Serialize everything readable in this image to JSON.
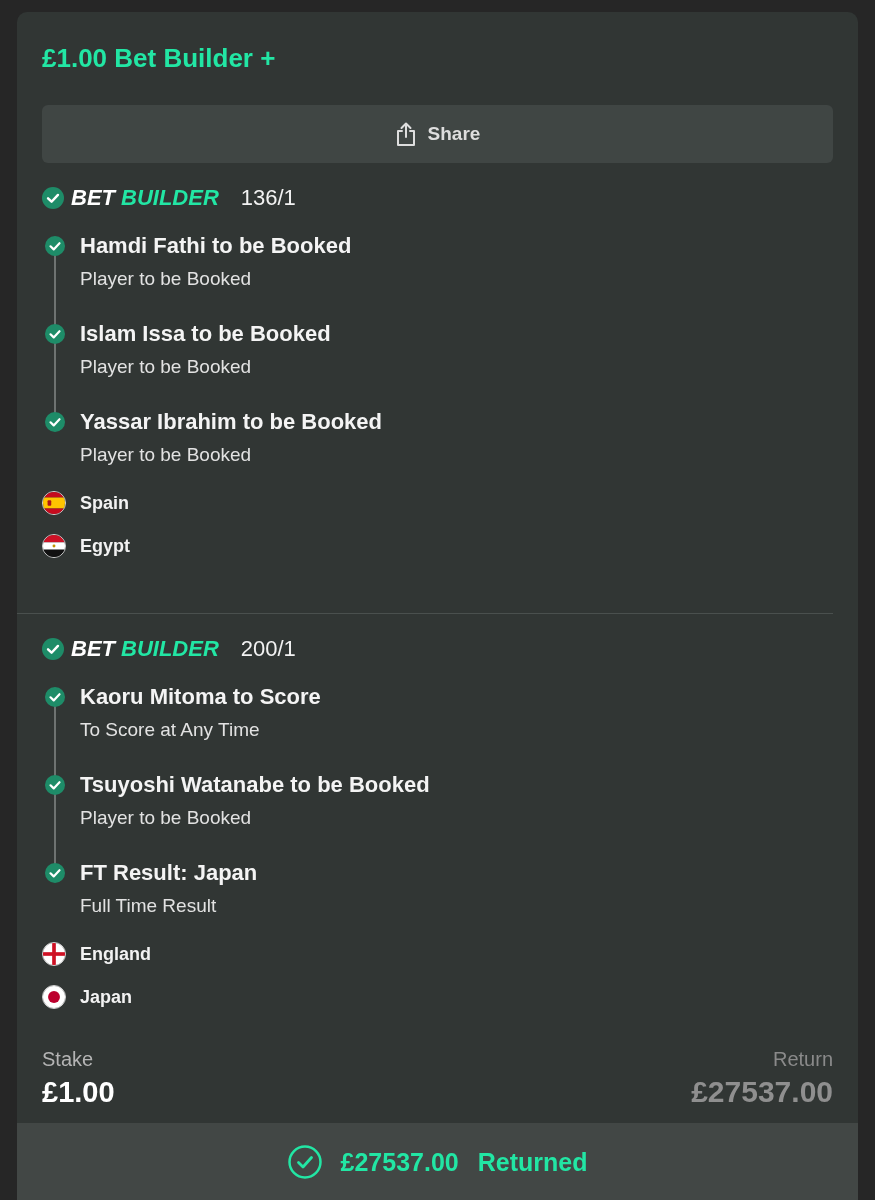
{
  "bet_card": {
    "title": "£1.00 Bet Builder +",
    "share_button": {
      "label": "Share"
    },
    "bets": [
      {
        "won": true,
        "logo": {
          "word_1": "BET",
          "word_2": "BUILDER"
        },
        "odds": "136/1",
        "legs": [
          {
            "selection": "Hamdi Fathi to be Booked",
            "market": "Player to be Booked",
            "won": true
          },
          {
            "selection": "Islam Issa to be Booked",
            "market": "Player to be Booked",
            "won": true
          },
          {
            "selection": "Yassar Ibrahim to be Booked",
            "market": "Player to be Booked",
            "won": true
          }
        ],
        "teams": [
          {
            "name": "Spain",
            "kind": "spain"
          },
          {
            "name": "Egypt",
            "kind": "egypt"
          }
        ]
      },
      {
        "won": true,
        "logo": {
          "word_1": "BET",
          "word_2": "BUILDER"
        },
        "odds": "200/1",
        "legs": [
          {
            "selection": "Kaoru Mitoma to Score",
            "market": "To Score at Any Time",
            "won": true
          },
          {
            "selection": "Tsuyoshi Watanabe to be Booked",
            "market": "Player to be Booked",
            "won": true
          },
          {
            "selection": "FT Result: Japan",
            "market": "Full Time Result",
            "won": true
          }
        ],
        "teams": [
          {
            "name": "England",
            "kind": "england"
          },
          {
            "name": "Japan",
            "kind": "japan"
          }
        ]
      }
    ],
    "stake": {
      "label": "Stake",
      "value": "£1.00"
    },
    "return": {
      "label": "Return",
      "value": "£27537.00"
    },
    "result": {
      "amount": "£27537.00",
      "status": "Returned"
    }
  }
}
